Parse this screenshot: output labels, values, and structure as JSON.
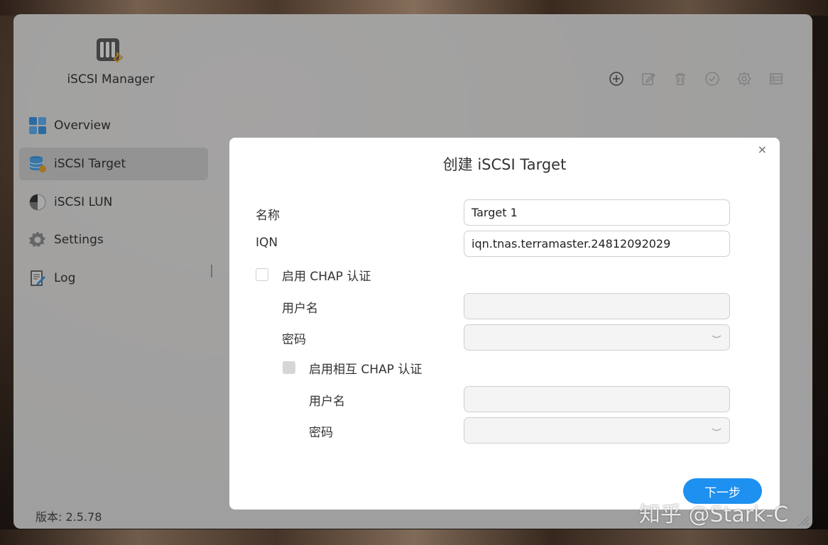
{
  "app": {
    "title": "iSCSI Manager",
    "version": "版本: 2.5.78"
  },
  "sidebar": {
    "items": [
      {
        "label": "Overview",
        "icon": "grid-icon"
      },
      {
        "label": "iSCSI Target",
        "icon": "database-icon",
        "active": true
      },
      {
        "label": "iSCSI LUN",
        "icon": "disk-icon"
      },
      {
        "label": "Settings",
        "icon": "gear-icon"
      },
      {
        "label": "Log",
        "icon": "log-icon"
      }
    ]
  },
  "toolbar": {
    "icons": [
      "add-icon",
      "edit-icon",
      "trash-icon",
      "check-icon",
      "gear-icon",
      "list-icon"
    ]
  },
  "modal": {
    "title": "创建 iSCSI Target",
    "close_glyph": "×",
    "name_label": "名称",
    "name_value": "Target 1",
    "iqn_label": "IQN",
    "iqn_value": "iqn.tnas.terramaster.24812092029",
    "chap_label": "启用 CHAP 认证",
    "chap_username_label": "用户名",
    "chap_password_label": "密码",
    "mutual_chap_label": "启用相互 CHAP 认证",
    "mutual_username_label": "用户名",
    "mutual_password_label": "密码",
    "next_label": "下一步"
  },
  "watermark": "知乎 @Stark-C",
  "colors": {
    "accent": "#1e90f0",
    "active_item_bg": "#c4c4c4"
  }
}
